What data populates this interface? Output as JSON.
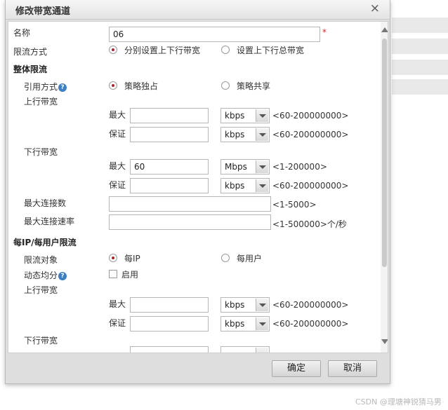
{
  "dialog": {
    "title": "修改带宽通道",
    "close_glyph": "×"
  },
  "form": {
    "name_label": "名称",
    "name_value": "06",
    "required_mark": "*",
    "limit_mode_label": "限流方式",
    "limit_mode_opt1": "分别设置上下行带宽",
    "limit_mode_opt2": "设置上下行总带宽",
    "overall_section": "整体限流",
    "ref_mode_label": "引用方式",
    "ref_mode_opt1": "策略独占",
    "ref_mode_opt2": "策略共享",
    "up_bandwidth_label": "上行带宽",
    "max_label": "最大",
    "guarantee_label": "保证",
    "down_bandwidth_label": "下行带宽",
    "up_max_value": "",
    "up_max_unit": "kbps",
    "up_max_range": "<60-200000000>",
    "up_guar_value": "",
    "up_guar_unit": "kbps",
    "up_guar_range": "<60-200000000>",
    "down_max_value": "60",
    "down_max_unit": "Mbps",
    "down_max_range": "<1-200000>",
    "down_guar_value": "",
    "down_guar_unit": "kbps",
    "down_guar_range": "<60-200000000>",
    "max_conn_label": "最大连接数",
    "max_conn_value": "",
    "max_conn_range": "<1-5000>",
    "max_conn_rate_label": "最大连接速率",
    "max_conn_rate_value": "",
    "max_conn_rate_range": "<1-500000>个/秒",
    "per_ip_section": "每IP/每用户限流",
    "limit_target_label": "限流对象",
    "limit_target_opt1": "每IP",
    "limit_target_opt2": "每用户",
    "dynamic_label": "动态均分",
    "dynamic_check_label": "启用",
    "ip_up_label": "上行带宽",
    "ip_up_max_value": "",
    "ip_up_max_unit": "kbps",
    "ip_up_max_range": "<60-200000000>",
    "ip_up_guar_value": "",
    "ip_up_guar_unit": "kbps",
    "ip_up_guar_range": "<60-200000000>",
    "ip_down_label": "下行带宽"
  },
  "help_glyph": "?",
  "footer": {
    "ok_label": "确定",
    "cancel_label": "取消"
  },
  "watermark": "CSDN @理塘神锐猜马男",
  "colors": {
    "radio_selected": "#b0202a",
    "help_icon": "#3b7fc4",
    "required": "#e02020"
  }
}
